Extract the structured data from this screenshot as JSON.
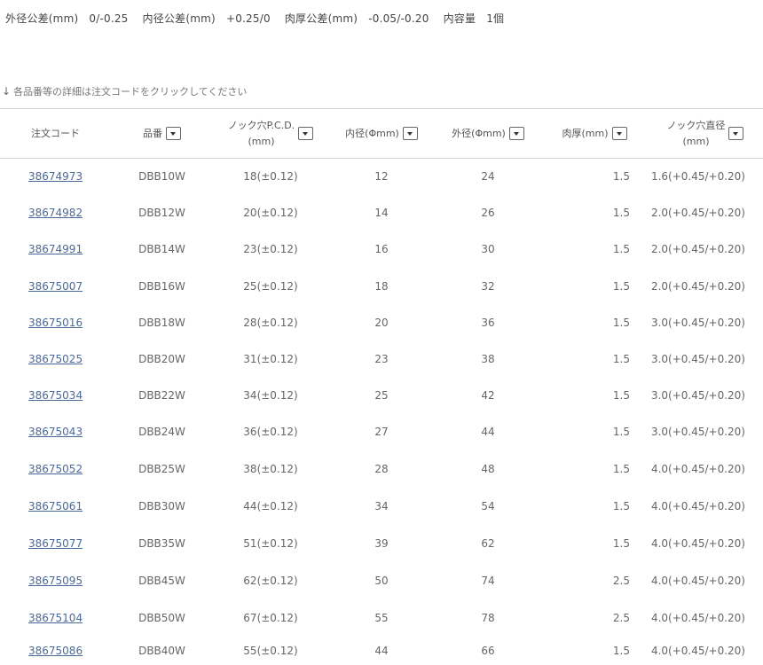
{
  "spec": [
    {
      "label": "外径公差(mm)",
      "value": "0/-0.25"
    },
    {
      "label": "内径公差(mm)",
      "value": "+0.25/0"
    },
    {
      "label": "肉厚公差(mm)",
      "value": "-0.05/-0.20"
    },
    {
      "label": "内容量",
      "value": "1個"
    }
  ],
  "hint": {
    "arrow": "↓",
    "text": "各品番等の詳細は注文コードをクリックしてください"
  },
  "table": {
    "headers": [
      {
        "line1": "注文コード",
        "line2": "",
        "sortable": false
      },
      {
        "line1": "品番",
        "line2": "",
        "sortable": true
      },
      {
        "line1": "ノック穴P.C.D.",
        "line2": "(mm)",
        "sortable": true
      },
      {
        "line1": "内径(Φmm)",
        "line2": "",
        "sortable": true
      },
      {
        "line1": "外径(Φmm)",
        "line2": "",
        "sortable": true
      },
      {
        "line1": "肉厚(mm)",
        "line2": "",
        "sortable": true
      },
      {
        "line1": "ノック穴直径",
        "line2": "(mm)",
        "sortable": true
      }
    ],
    "rows": [
      [
        "38674973",
        "DBB10W",
        "18(±0.12)",
        "12",
        "24",
        "1.5",
        "1.6(+0.45/+0.20)"
      ],
      [
        "38674982",
        "DBB12W",
        "20(±0.12)",
        "14",
        "26",
        "1.5",
        "2.0(+0.45/+0.20)"
      ],
      [
        "38674991",
        "DBB14W",
        "23(±0.12)",
        "16",
        "30",
        "1.5",
        "2.0(+0.45/+0.20)"
      ],
      [
        "38675007",
        "DBB16W",
        "25(±0.12)",
        "18",
        "32",
        "1.5",
        "2.0(+0.45/+0.20)"
      ],
      [
        "38675016",
        "DBB18W",
        "28(±0.12)",
        "20",
        "36",
        "1.5",
        "3.0(+0.45/+0.20)"
      ],
      [
        "38675025",
        "DBB20W",
        "31(±0.12)",
        "23",
        "38",
        "1.5",
        "3.0(+0.45/+0.20)"
      ],
      [
        "38675034",
        "DBB22W",
        "34(±0.12)",
        "25",
        "42",
        "1.5",
        "3.0(+0.45/+0.20)"
      ],
      [
        "38675043",
        "DBB24W",
        "36(±0.12)",
        "27",
        "44",
        "1.5",
        "3.0(+0.45/+0.20)"
      ],
      [
        "38675052",
        "DBB25W",
        "38(±0.12)",
        "28",
        "48",
        "1.5",
        "4.0(+0.45/+0.20)"
      ],
      [
        "38675061",
        "DBB30W",
        "44(±0.12)",
        "34",
        "54",
        "1.5",
        "4.0(+0.45/+0.20)"
      ],
      [
        "38675077",
        "DBB35W",
        "51(±0.12)",
        "39",
        "62",
        "1.5",
        "4.0(+0.45/+0.20)"
      ],
      [
        "38675095",
        "DBB45W",
        "62(±0.12)",
        "50",
        "74",
        "2.5",
        "4.0(+0.45/+0.20)"
      ],
      [
        "38675104",
        "DBB50W",
        "67(±0.12)",
        "55",
        "78",
        "2.5",
        "4.0(+0.45/+0.20)"
      ],
      [
        "38675086",
        "DBB40W",
        "55(±0.12)",
        "44",
        "66",
        "1.5",
        "4.0(+0.45/+0.20)"
      ]
    ]
  }
}
